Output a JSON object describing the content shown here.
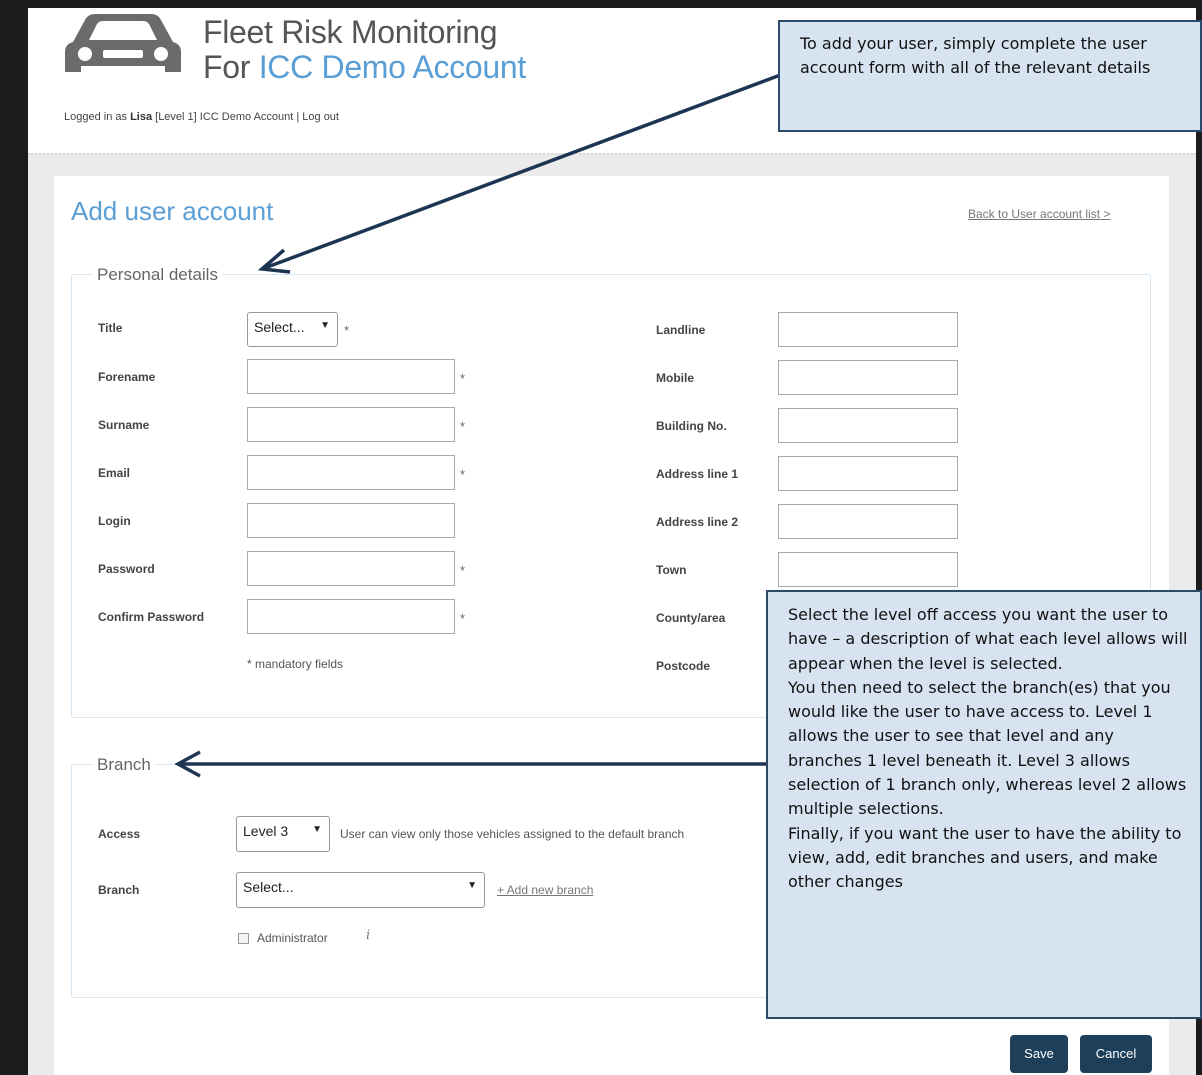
{
  "header": {
    "brand_line1": "Fleet Risk Monitoring",
    "brand_line2_prefix": "For ",
    "brand_line2_account": "ICC Demo Account",
    "login_prefix": "Logged in as ",
    "login_user": "Lisa",
    "login_suffix": " [Level 1]  ICC Demo Account  |  ",
    "logout": "Log out"
  },
  "page": {
    "title": "Add user account",
    "back_link": "Back to User account list >"
  },
  "personal": {
    "legend": "Personal details",
    "title_label": "Title",
    "title_select": "Select...",
    "forename": "Forename",
    "surname": "Surname",
    "email": "Email",
    "login": "Login",
    "password": "Password",
    "confirm_password": "Confirm Password",
    "mandatory_note": "* mandatory fields",
    "required_mark": "*",
    "landline": "Landline",
    "mobile": "Mobile",
    "building_no": "Building No.",
    "address1": "Address line 1",
    "address2": "Address line 2",
    "town": "Town",
    "county": "County/area",
    "postcode": "Postcode"
  },
  "branch": {
    "legend": "Branch",
    "access_label": "Access",
    "access_value": "Level 3",
    "access_description": "User can view only those vehicles assigned to the default branch",
    "branch_label": "Branch",
    "branch_value": "Select...",
    "add_branch": "+ Add new branch",
    "administrator": "Administrator",
    "info_glyph": "i"
  },
  "buttons": {
    "save": "Save",
    "cancel": "Cancel"
  },
  "callouts": {
    "top": "To add your user, simply complete the user account form with all of the relevant details",
    "right": [
      "Select the level off access you want the user to have – a description of what each level allows will appear when the level is selected.",
      "You then need to select the branch(es) that you would like the user to have access to.  Level 1 allows the user to see that level and any branches 1 level beneath it.  Level 3 allows selection of 1 branch only, whereas level 2 allows multiple selections.",
      "Finally, if you want the user to have the ability to view, add, edit branches and users, and make other changes"
    ]
  },
  "colors": {
    "accent": "#5a9ed6",
    "button": "#1d3f5a",
    "callout_fill": "#d7e3f1",
    "callout_border": "#2e4a6b"
  },
  "icons": {
    "logo": "car-logo-icon",
    "caret": "caret-down-icon",
    "info": "info-icon"
  }
}
